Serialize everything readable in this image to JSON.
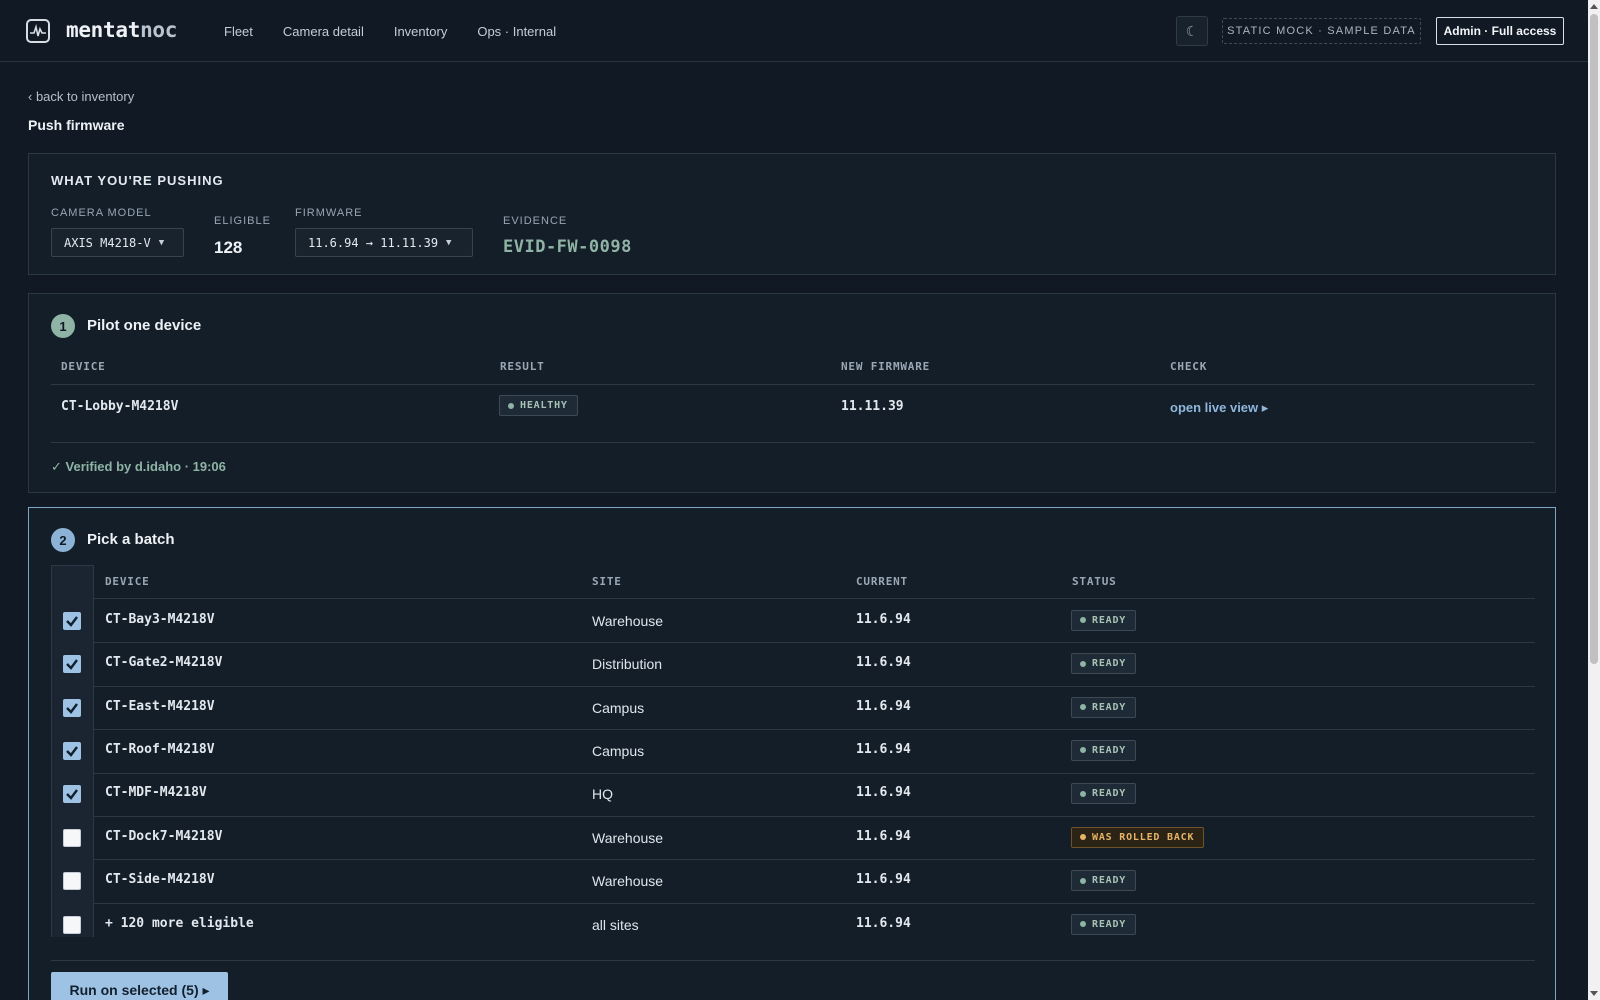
{
  "header": {
    "brand_main": "mentat",
    "brand_suffix": "noc",
    "nav": [
      "Fleet",
      "Camera detail",
      "Inventory",
      "Ops · Internal"
    ],
    "theme_icon": "moon-icon",
    "mock_badge": "STATIC MOCK · SAMPLE DATA",
    "admin_label": "Admin · Full access"
  },
  "breadcrumb": {
    "back": "‹ back to inventory",
    "title": "Push firmware"
  },
  "pushing": {
    "heading": "WHAT YOU'RE PUSHING",
    "model_label": "CAMERA MODEL",
    "model_value": "AXIS M4218-V",
    "eligible_label": "ELIGIBLE",
    "eligible_value": "128",
    "firmware_label": "FIRMWARE",
    "firmware_value": "11.6.94 → 11.11.39",
    "evidence_label": "EVIDENCE",
    "evidence_value": "EVID-FW-0098"
  },
  "pilot": {
    "step": "1",
    "title": "Pilot one device",
    "columns": [
      "DEVICE",
      "RESULT",
      "NEW FIRMWARE",
      "CHECK"
    ],
    "device": "CT-Lobby-M4218V",
    "result": "HEALTHY",
    "new_firmware": "11.11.39",
    "check_link": "open live view ▸",
    "verified": "✓ Verified by d.idaho · 19:06"
  },
  "batch": {
    "step": "2",
    "title": "Pick a batch",
    "columns": [
      "DEVICE",
      "SITE",
      "CURRENT",
      "STATUS"
    ],
    "rows": [
      {
        "device": "CT-Bay3-M4218V",
        "site": "Warehouse",
        "current": "11.6.94",
        "status": "READY",
        "checked": true
      },
      {
        "device": "CT-Gate2-M4218V",
        "site": "Distribution",
        "current": "11.6.94",
        "status": "READY",
        "checked": true
      },
      {
        "device": "CT-East-M4218V",
        "site": "Campus",
        "current": "11.6.94",
        "status": "READY",
        "checked": true
      },
      {
        "device": "CT-Roof-M4218V",
        "site": "Campus",
        "current": "11.6.94",
        "status": "READY",
        "checked": true
      },
      {
        "device": "CT-MDF-M4218V",
        "site": "HQ",
        "current": "11.6.94",
        "status": "READY",
        "checked": true
      },
      {
        "device": "CT-Dock7-M4218V",
        "site": "Warehouse",
        "current": "11.6.94",
        "status": "WAS ROLLED BACK",
        "checked": false
      },
      {
        "device": "CT-Side-M4218V",
        "site": "Warehouse",
        "current": "11.6.94",
        "status": "READY",
        "checked": false
      },
      {
        "device": "+ 120 more eligible",
        "site": "all sites",
        "current": "11.6.94",
        "status": "READY",
        "checked": false
      }
    ],
    "run_label": "Run on selected (5) ▸"
  },
  "colors": {
    "background": "#111a24",
    "accent_blue": "#9ec2e3",
    "accent_green": "#8fb3a4",
    "warning": "#e6b466"
  }
}
